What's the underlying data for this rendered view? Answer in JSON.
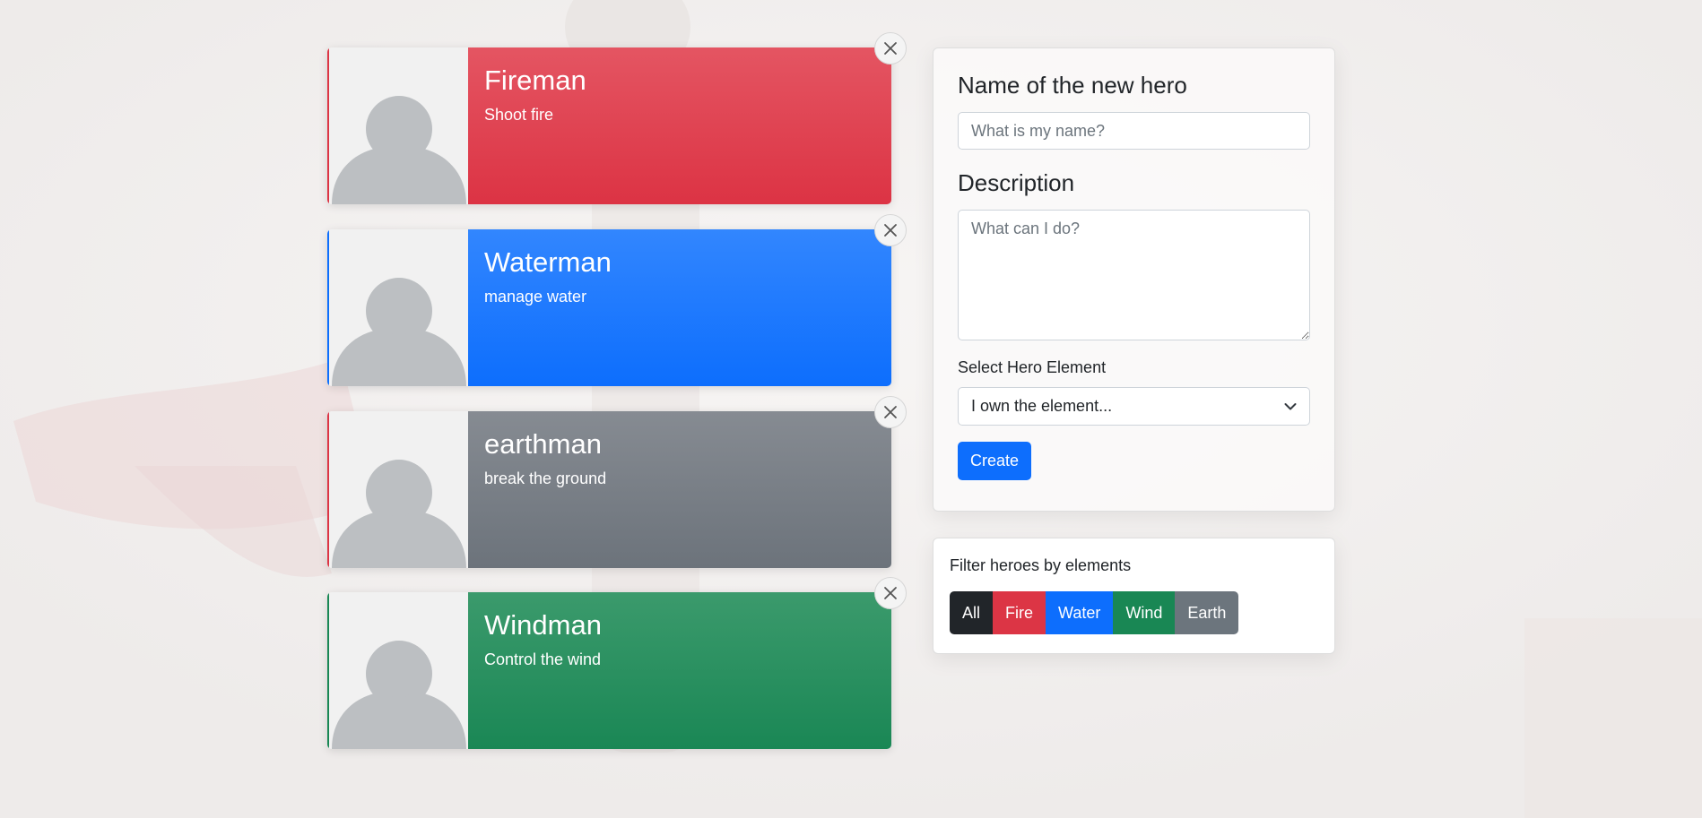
{
  "heroes": [
    {
      "name": "Fireman",
      "description": "Shoot fire",
      "element": "fire"
    },
    {
      "name": "Waterman",
      "description": "manage water",
      "element": "water"
    },
    {
      "name": "earthman",
      "description": "break the ground",
      "element": "earth"
    },
    {
      "name": "Windman",
      "description": "Control the wind",
      "element": "wind"
    }
  ],
  "form": {
    "name_label": "Name of the new hero",
    "name_placeholder": "What is my name?",
    "description_label": "Description",
    "description_placeholder": "What can I do?",
    "select_label": "Select Hero Element",
    "select_value": "I own the element...",
    "create_label": "Create"
  },
  "filter": {
    "title": "Filter heroes by elements",
    "buttons": [
      {
        "label": "All",
        "color": "#212529"
      },
      {
        "label": "Fire",
        "color": "#dc3545"
      },
      {
        "label": "Water",
        "color": "#0d6efd"
      },
      {
        "label": "Wind",
        "color": "#198754"
      },
      {
        "label": "Earth",
        "color": "#6c757d"
      }
    ]
  },
  "colors": {
    "fire": "#dc3545",
    "water": "#0d6efd",
    "earth": "#6c757d",
    "wind": "#198754",
    "avatar_silhouette": "#bcbfc2"
  },
  "icons": {
    "close": "close-icon",
    "chevron": "chevron-down-icon",
    "avatar": "person-placeholder-icon"
  }
}
